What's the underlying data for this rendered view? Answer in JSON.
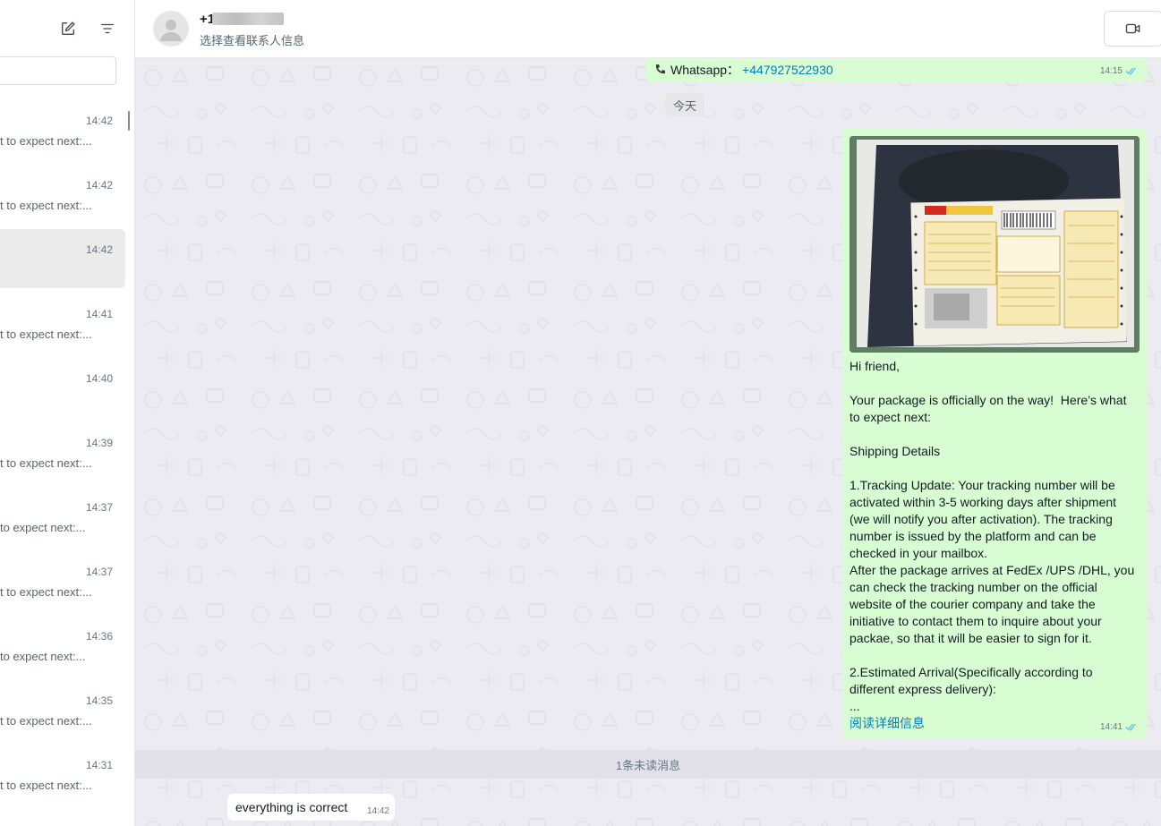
{
  "sidebar": {
    "chats": [
      {
        "time": "14:42",
        "preview": "t to expect next:..."
      },
      {
        "time": "14:42",
        "preview": "t to expect next:..."
      },
      {
        "time": "14:42",
        "preview": ""
      },
      {
        "time": "14:41",
        "preview": "t to expect next:..."
      },
      {
        "time": "14:40",
        "preview": ""
      },
      {
        "time": "14:39",
        "preview": "t to expect next:..."
      },
      {
        "time": "14:37",
        "preview": " to expect next:..."
      },
      {
        "time": "14:37",
        "preview": "t to expect next:..."
      },
      {
        "time": "14:36",
        "preview": " to expect next:..."
      },
      {
        "time": "14:35",
        "preview": "t to expect next:..."
      },
      {
        "time": "14:31",
        "preview": "t to expect next:..."
      }
    ]
  },
  "header": {
    "contact_name": "+1",
    "subtitle": "选择查看联系人信息"
  },
  "messages": {
    "whatsapp_label": "Whatsapp：",
    "whatsapp_number": "+447927522930",
    "whatsapp_time": "14:15",
    "date_divider": "今天",
    "big_message": {
      "greeting": "Hi friend,",
      "intro": "Your package is officially on the way!  Here’s what to expect next:",
      "section": "Shipping Details",
      "tracking": "1.Tracking Update: Your tracking number will be activated within 3-5 working days after shipment (we will notify you after activation). The tracking number is issued by the platform and can be checked in your mailbox.\nAfter the package arrives at FedEx /UPS /DHL, you can check the tracking number on the official website of the courier company and take the initiative to contact them to inquire about your packae, so that it will be easier to sign for it.",
      "arrival": "2.Estimated Arrival(Specifically according to different express delivery):\n...",
      "read_more": "阅读详细信息",
      "time": "14:41"
    },
    "unread_divider": "1条未读消息",
    "incoming": {
      "text": "everything is correct",
      "time": "14:42"
    }
  },
  "colors": {
    "outgoing_bubble": "#d9fdd3",
    "link": "#027eb5",
    "chat_background": "#ecebf2",
    "read_ticks": "#53bdeb"
  }
}
